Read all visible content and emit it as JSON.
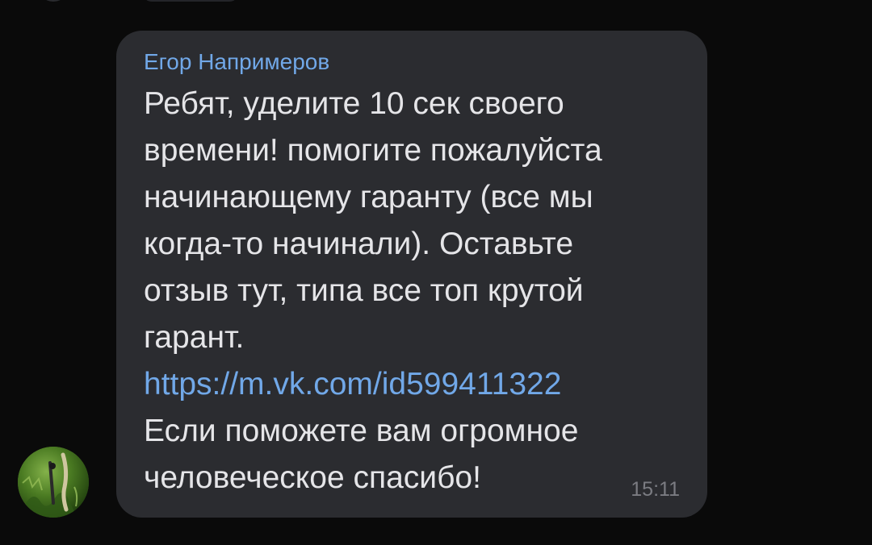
{
  "message": {
    "sender_name": "Егор Напримеров",
    "lines_before_link": [
      "Ребят, уделите 10 сек своего",
      "времени! помогите пожалуйста",
      "начинающему гаранту (все мы",
      "когда-то начинали). Оставьте",
      "отзыв тут, типа все топ крутой",
      "гарант."
    ],
    "link_text": "https://m.vk.com/id599411322",
    "lines_after_link": [
      "Если поможете вам огромное",
      "человеческое спасибо!"
    ],
    "time": "15:11"
  },
  "colors": {
    "background": "#0a0a0a",
    "bubble": "#2b2c30",
    "accent_blue": "#71a8e8",
    "text": "#e5e5e8",
    "time_text": "#7b7c82"
  },
  "icons": {
    "avatar": "avatar-photo-grass"
  }
}
